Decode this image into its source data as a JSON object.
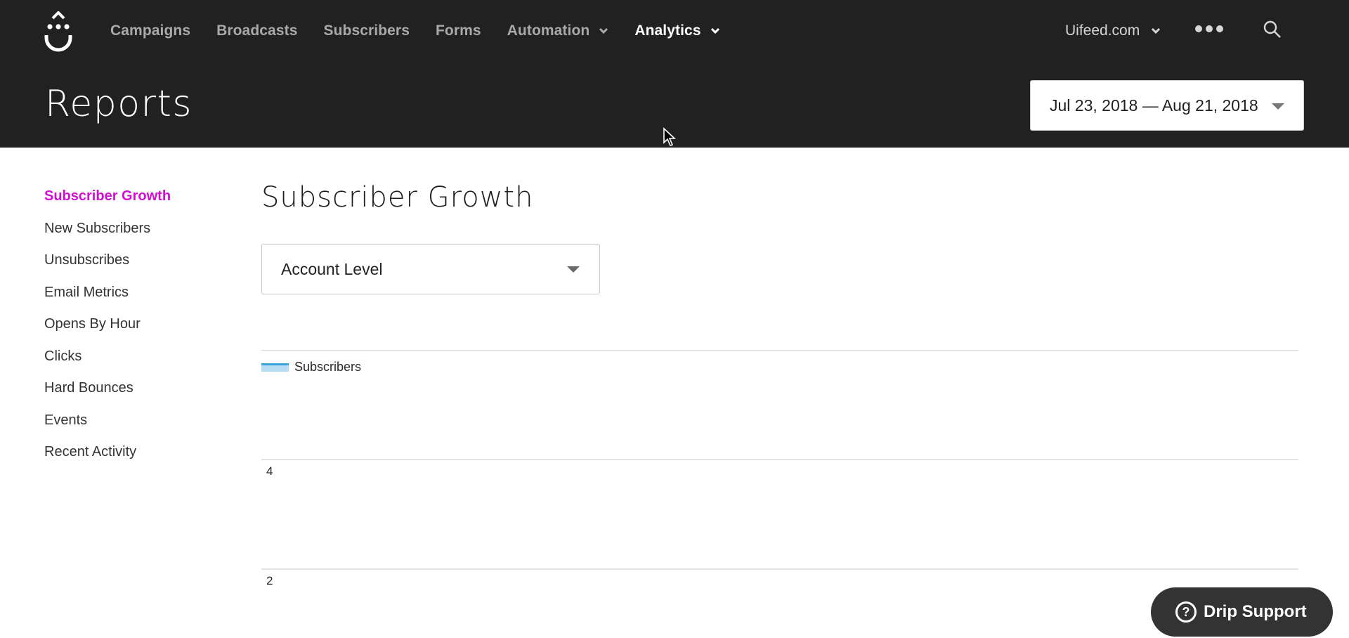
{
  "app": {
    "brand_icon": "drip-logo-icon"
  },
  "nav": {
    "items": [
      {
        "label": "Campaigns",
        "has_dropdown": false,
        "active": false
      },
      {
        "label": "Broadcasts",
        "has_dropdown": false,
        "active": false
      },
      {
        "label": "Subscribers",
        "has_dropdown": false,
        "active": false
      },
      {
        "label": "Forms",
        "has_dropdown": false,
        "active": false
      },
      {
        "label": "Automation",
        "has_dropdown": true,
        "active": false
      },
      {
        "label": "Analytics",
        "has_dropdown": true,
        "active": true
      }
    ],
    "account_label": "Uifeed.com",
    "more_icon": "ellipsis-icon",
    "search_icon": "search-icon"
  },
  "header": {
    "title": "Reports",
    "date_range": "Jul 23, 2018 — Aug 21, 2018"
  },
  "sidebar": {
    "items": [
      {
        "label": "Subscriber Growth",
        "active": true
      },
      {
        "label": "New Subscribers",
        "active": false
      },
      {
        "label": "Unsubscribes",
        "active": false
      },
      {
        "label": "Email Metrics",
        "active": false
      },
      {
        "label": "Opens By Hour",
        "active": false
      },
      {
        "label": "Clicks",
        "active": false
      },
      {
        "label": "Hard Bounces",
        "active": false
      },
      {
        "label": "Events",
        "active": false
      },
      {
        "label": "Recent Activity",
        "active": false
      }
    ]
  },
  "main": {
    "title": "Subscriber Growth",
    "level_select": "Account Level"
  },
  "chart_data": {
    "type": "area",
    "title": "",
    "legend": [
      {
        "name": "Subscribers",
        "color": "#3aa3de",
        "fill": "#b7ddf4"
      }
    ],
    "legend_position": "top-left",
    "y_ticks": [
      4,
      2
    ],
    "ylim_visible": [
      1.5,
      6
    ],
    "grid": true,
    "series": [
      {
        "name": "Subscribers",
        "values": []
      }
    ]
  },
  "colors": {
    "topbar": "#212121",
    "accent": "#d10fd0",
    "series_line": "#3aa3de",
    "series_fill": "#b7ddf4",
    "support_button": "#333333"
  },
  "support": {
    "label": "Drip Support",
    "icon": "help-circle-icon"
  }
}
